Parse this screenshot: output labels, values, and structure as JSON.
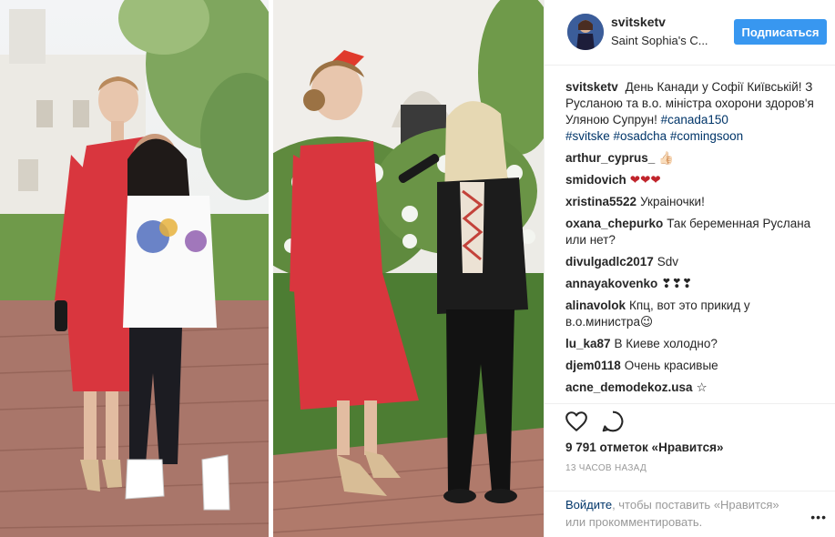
{
  "post": {
    "username": "svitsketv",
    "location": "Saint Sophia's C...",
    "follow_label": "Подписаться",
    "caption": {
      "user": "svitsketv",
      "text": "День Канади у Софії Київській! З Русланою та в.о. міністра охорони здоров'я Уляною Супрун!",
      "hashtags_line1": "#canada150",
      "hashtags_line2": [
        "#svitske",
        "#osadcha",
        "#comingsoon"
      ]
    },
    "comments": [
      {
        "user": "arthur_cyprus_",
        "text": "👍🏻"
      },
      {
        "user": "smidovich",
        "text": "❤❤❤"
      },
      {
        "user": "xristina5522",
        "text": "Украіночки!"
      },
      {
        "user": "oxana_chepurko",
        "text": "Так беременная Руслана или нет?"
      },
      {
        "user": "divulgadlc2017",
        "text": "Sdv"
      },
      {
        "user": "annayakovenko",
        "text": "❣❣❣"
      },
      {
        "user": "alinavolok",
        "text": "Кпц, вот это прикид у в.о.министра😉"
      },
      {
        "user": "lu_ka87",
        "text": "В Киеве холодно?"
      },
      {
        "user": "djem0118",
        "text": "Очень красивые"
      },
      {
        "user": "acne_demodekoz.usa",
        "text": "☆"
      }
    ],
    "likes": "9 791 отметок «Нравится»",
    "timestamp": "13 часов назад",
    "login_prompt": {
      "link": "Войдите",
      "text": ", чтобы поставить «Нравится» или прокомментировать."
    },
    "more_label": "•••"
  },
  "icons": {
    "like": "heart-icon",
    "comment": "comment-bubble-icon"
  },
  "colors": {
    "accent": "#3897f0",
    "link": "#003569",
    "dress": "#d9363e"
  }
}
